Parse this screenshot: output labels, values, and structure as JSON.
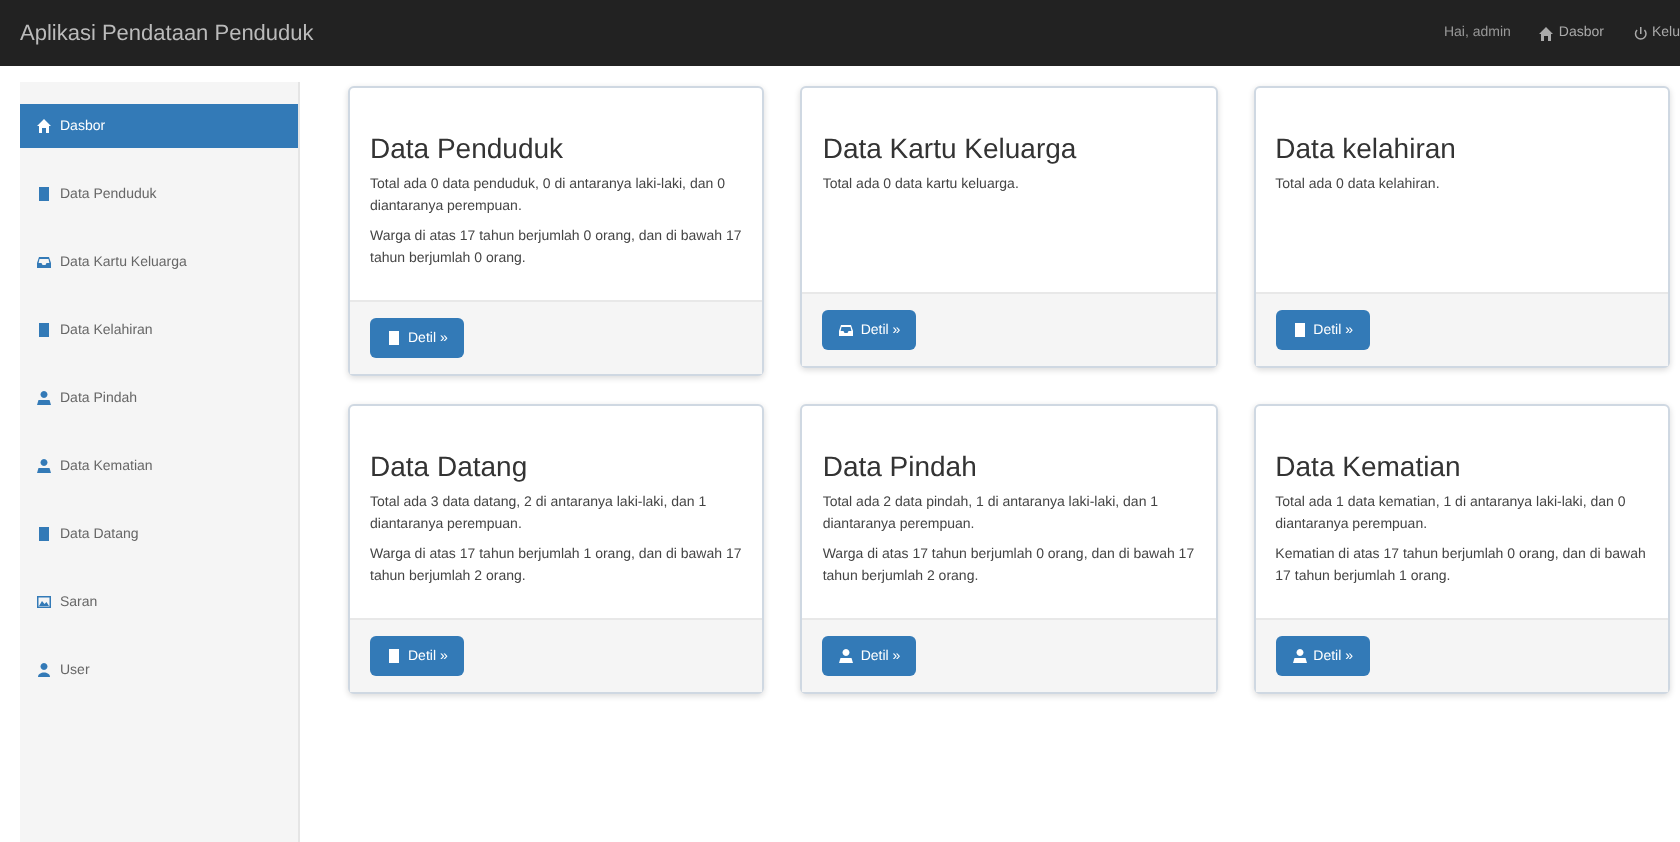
{
  "navbar": {
    "title": "Aplikasi Pendataan Penduduk",
    "greeting": "Hai, admin",
    "links": [
      {
        "label": "Dasbor"
      },
      {
        "label": "Kelu"
      }
    ]
  },
  "sidebar": {
    "items": [
      {
        "label": "Dasbor",
        "selected": true
      },
      {
        "label": "Data Penduduk",
        "selected": false
      },
      {
        "label": "Data Kartu Keluarga",
        "selected": false
      },
      {
        "label": "Data Kelahiran",
        "selected": false
      },
      {
        "label": "Data Pindah",
        "selected": false
      },
      {
        "label": "Data Kematian",
        "selected": false
      },
      {
        "label": "Data Datang",
        "selected": false
      },
      {
        "label": "Saran",
        "selected": false
      },
      {
        "label": "User",
        "selected": false
      }
    ]
  },
  "cards": [
    {
      "title": "Data Penduduk",
      "paragraphs": [
        "Total ada 0 data penduduk, 0 di antaranya laki-laki, dan 0 diantaranya perempuan.",
        "Warga di atas 17 tahun berjumlah 0 orang, dan di bawah 17 tahun berjumlah 0 orang."
      ],
      "button": "Detil »"
    },
    {
      "title": "Data Kartu Keluarga",
      "paragraphs": [
        "Total ada 0 data kartu keluarga."
      ],
      "button": "Detil »"
    },
    {
      "title": "Data kelahiran",
      "paragraphs": [
        "Total ada 0 data kelahiran."
      ],
      "button": "Detil »"
    },
    {
      "title": "Data Datang",
      "paragraphs": [
        "Total ada 3 data datang, 2 di antaranya laki-laki, dan 1 diantaranya perempuan.",
        "Warga di atas 17 tahun berjumlah 1 orang, dan di bawah 17 tahun berjumlah 2 orang."
      ],
      "button": "Detil »"
    },
    {
      "title": "Data Pindah",
      "paragraphs": [
        "Total ada 2 data pindah, 1 di antaranya laki-laki, dan 1 diantaranya perempuan.",
        "Warga di atas 17 tahun berjumlah 0 orang, dan di bawah 17 tahun berjumlah 2 orang."
      ],
      "button": "Detil »"
    },
    {
      "title": "Data Kematian",
      "paragraphs": [
        "Total ada 1 data kematian, 1 di antaranya laki-laki, dan 0 diantaranya perempuan.",
        "Kematian di atas 17 tahun berjumlah 0 orang, dan di bawah 17 tahun berjumlah 1 orang."
      ],
      "button": "Detil »"
    }
  ]
}
